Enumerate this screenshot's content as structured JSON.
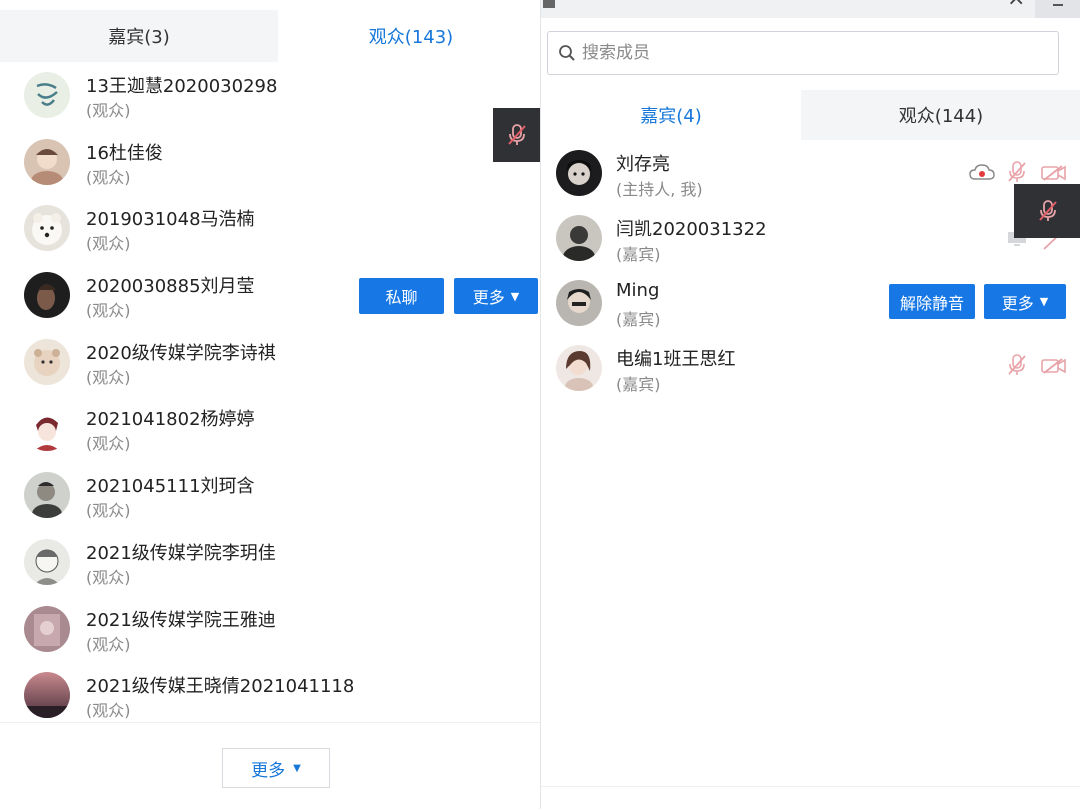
{
  "left": {
    "tabs": [
      {
        "label": "嘉宾(3)",
        "active": false
      },
      {
        "label": "观众(143)",
        "active": true
      }
    ],
    "members": [
      {
        "name": "13王迦慧2020030298",
        "role": "(观众)"
      },
      {
        "name": "16杜佳俊",
        "role": "(观众)"
      },
      {
        "name": "2019031048马浩楠",
        "role": "(观众)"
      },
      {
        "name": "2020030885刘月莹",
        "role": "(观众)"
      },
      {
        "name": "2020级传媒学院李诗祺",
        "role": "(观众)"
      },
      {
        "name": "2021041802杨婷婷",
        "role": "(观众)"
      },
      {
        "name": "2021045111刘珂含",
        "role": "(观众)"
      },
      {
        "name": "2021级传媒学院李玥佳",
        "role": "(观众)"
      },
      {
        "name": "2021级传媒学院王雅迪",
        "role": "(观众)"
      },
      {
        "name": "2021级传媒王晓倩2021041118",
        "role": "(观众)"
      }
    ],
    "row_actions": {
      "private_chat": "私聊",
      "more": "更多"
    },
    "footer_more": "更多"
  },
  "right": {
    "search_placeholder": "搜索成员",
    "tabs": [
      {
        "label": "嘉宾(4)",
        "active": true
      },
      {
        "label": "观众(144)",
        "active": false
      }
    ],
    "members": [
      {
        "name": "刘存亮",
        "role": "(主持人, 我)"
      },
      {
        "name": "闫凯2020031322",
        "role": "(嘉宾)"
      },
      {
        "name": "Ming",
        "role": "(嘉宾)"
      },
      {
        "name": "电编1班王思红",
        "role": "(嘉宾)"
      }
    ],
    "row_actions": {
      "unmute": "解除静音",
      "more": "更多"
    }
  },
  "colors": {
    "accent": "#1677e5",
    "tab_inactive_bg": "#f4f5f7",
    "muted_icon": "#e8a3a8",
    "floating_bar": "#2f3135"
  },
  "icons": {
    "muted_mic": "muted-mic-icon",
    "video_off": "video-off-icon",
    "cloud_record": "cloud-record-icon",
    "search": "search-icon",
    "caret": "caret-down-icon"
  }
}
